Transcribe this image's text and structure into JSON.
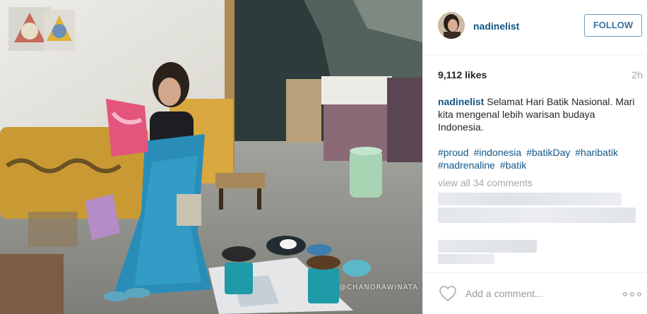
{
  "post": {
    "photo_alt": "",
    "watermark": "@CHANDRAWINATA"
  },
  "header": {
    "username": "nadinelist",
    "follow_label": "FOLLOW"
  },
  "stats": {
    "likes": "9,112 likes",
    "time": "2h"
  },
  "caption": {
    "user": "nadinelist",
    "text": "Selamat Hari Batik Nasional. Mari kita mengenal lebih warisan budaya Indonesia.",
    "hashtags": [
      "#proud",
      "#indonesia",
      "#batikDay",
      "#haribatik",
      "#nadrenaline",
      "#batik"
    ]
  },
  "comments": {
    "view_all": "view all 34 comments"
  },
  "footer": {
    "comment_placeholder": "Add a comment..."
  },
  "icons": {
    "heart": "heart-outline-icon",
    "more": "more-options-icon"
  },
  "colors": {
    "link": "#125688",
    "follow": "#3f729b",
    "muted": "#a5a7aa"
  }
}
